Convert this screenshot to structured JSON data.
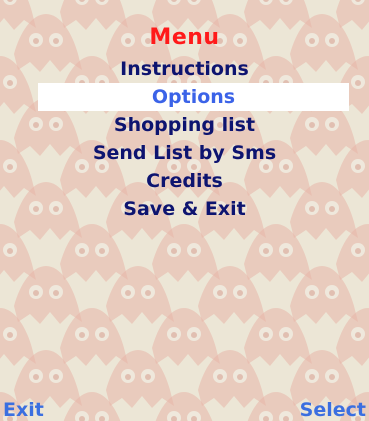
{
  "screen": {
    "title": "Menu",
    "background_pattern_icon": "ghost-icon",
    "colors": {
      "background": "#ece6d6",
      "pattern": "#e8b5a8",
      "title": "#ff1a1a",
      "item": "#0d1470",
      "selected_item": "#3b63e8",
      "selected_background": "#ffffff",
      "softkey": "#3b6fe0"
    }
  },
  "menu": {
    "items": [
      {
        "label": "Instructions",
        "selected": false
      },
      {
        "label": "Options",
        "selected": true
      },
      {
        "label": "Shopping list",
        "selected": false
      },
      {
        "label": "Send List by Sms",
        "selected": false
      },
      {
        "label": "Credits",
        "selected": false
      },
      {
        "label": "Save & Exit",
        "selected": false
      }
    ]
  },
  "softkeys": {
    "left_label": "Exit",
    "right_label": "Select"
  }
}
